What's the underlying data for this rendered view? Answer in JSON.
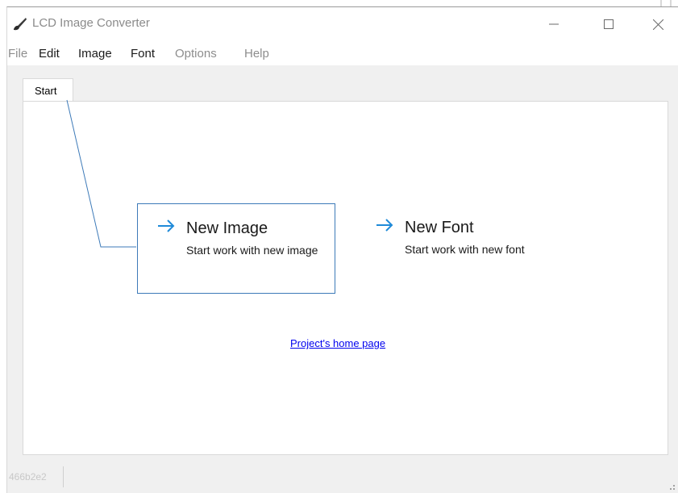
{
  "window": {
    "title": "LCD Image Converter",
    "icon": "brush-icon",
    "controls": {
      "minimize": "minimize-icon",
      "maximize": "maximize-icon",
      "close": "close-icon"
    }
  },
  "menu": {
    "items": [
      {
        "label": "File",
        "enabled": false
      },
      {
        "label": "Edit",
        "enabled": true
      },
      {
        "label": "Image",
        "enabled": true
      },
      {
        "label": "Font",
        "enabled": true
      },
      {
        "label": "Options",
        "enabled": false
      },
      {
        "label": "Help",
        "enabled": false
      }
    ]
  },
  "tabs": [
    {
      "label": "Start"
    }
  ],
  "start": {
    "new_image": {
      "title": "New Image",
      "desc": "Start work with new image",
      "icon": "arrow-right-icon"
    },
    "new_font": {
      "title": "New Font",
      "desc": "Start work with new font",
      "icon": "arrow-right-icon"
    },
    "home_link": "Project's home page"
  },
  "status": {
    "text": "466b2e2"
  },
  "colors": {
    "accent": "#1f8ad8",
    "card_border": "#3d7ab8",
    "link": "#0000ee"
  }
}
